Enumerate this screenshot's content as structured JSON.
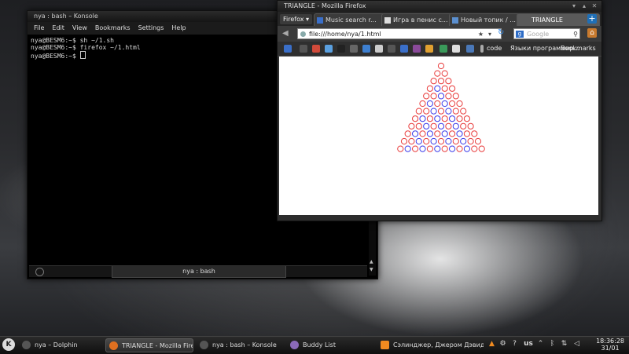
{
  "konsole": {
    "title": "nya : bash – Konsole",
    "menu": [
      "File",
      "Edit",
      "View",
      "Bookmarks",
      "Settings",
      "Help"
    ],
    "lines": [
      "nya@BESM6:~$ sh ~/1.sh",
      "nya@BESM6:~$ firefox ~/1.html",
      "nya@BESM6:~$ "
    ],
    "tab_label": "nya : bash"
  },
  "firefox": {
    "title": "TRIANGLE - Mozilla Firefox",
    "menu_button": "Firefox",
    "tabs": [
      {
        "label": "Music search r..."
      },
      {
        "label": "Игра в пенис с..."
      },
      {
        "label": "Новый топик / ..."
      },
      {
        "label": "TRIANGLE"
      }
    ],
    "url": "file:///home/nya/1.html",
    "search_placeholder": "Google",
    "bookmarks_text": [
      "code",
      "Языки программир..."
    ],
    "bookmarks_menu": "Bookmarks",
    "triangle": {
      "rows": 12,
      "colors": {
        "red": "#e83a3a",
        "blue": "#3a3ae8"
      }
    }
  },
  "taskbar": {
    "tasks": [
      "nya – Dolphin",
      "TRIANGLE - Mozilla Firefox",
      "nya : bash – Konsole",
      "Buddy List",
      "Сэлинджер, Джером Дэвид"
    ],
    "keyboard_layout": "us",
    "time": "18:36:28",
    "date": "31/01"
  }
}
